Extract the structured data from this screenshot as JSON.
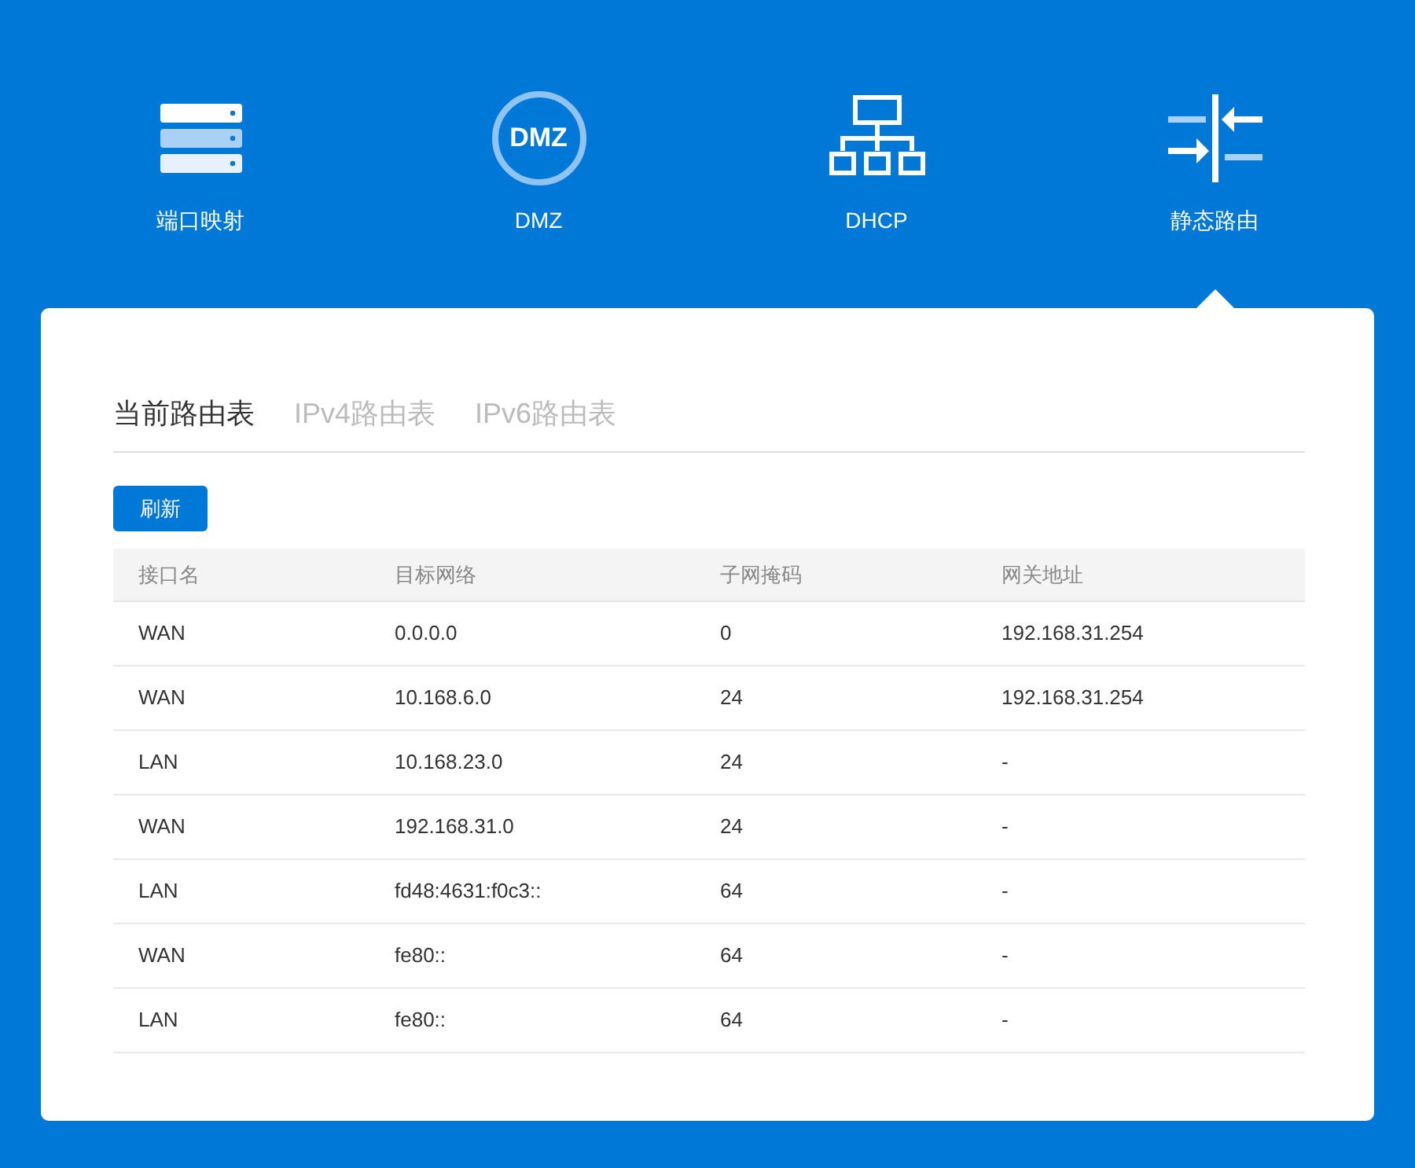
{
  "nav_items": [
    {
      "label": "端口映射",
      "kind": "ports",
      "selected": false
    },
    {
      "label": "DMZ",
      "kind": "dmz",
      "icon_text": "DMZ",
      "selected": false
    },
    {
      "label": "DHCP",
      "kind": "dhcp",
      "selected": false
    },
    {
      "label": "静态路由",
      "kind": "routes",
      "selected": true
    }
  ],
  "tabs": [
    {
      "label": "当前路由表",
      "selected": true
    },
    {
      "label": "IPv4路由表",
      "selected": false
    },
    {
      "label": "IPv6路由表",
      "selected": false
    }
  ],
  "refresh_button": "刷新",
  "table": {
    "columns": [
      "接口名",
      "目标网络",
      "子网掩码",
      "网关地址"
    ],
    "rows": [
      [
        "WAN",
        "0.0.0.0",
        "0",
        "192.168.31.254"
      ],
      [
        "WAN",
        "10.168.6.0",
        "24",
        "192.168.31.254"
      ],
      [
        "LAN",
        "10.168.23.0",
        "24",
        "-"
      ],
      [
        "WAN",
        "192.168.31.0",
        "24",
        "-"
      ],
      [
        "LAN",
        "fd48:4631:f0c3::",
        "64",
        "-"
      ],
      [
        "WAN",
        "fe80::",
        "64",
        "-"
      ],
      [
        "LAN",
        "fe80::",
        "64",
        "-"
      ]
    ]
  }
}
